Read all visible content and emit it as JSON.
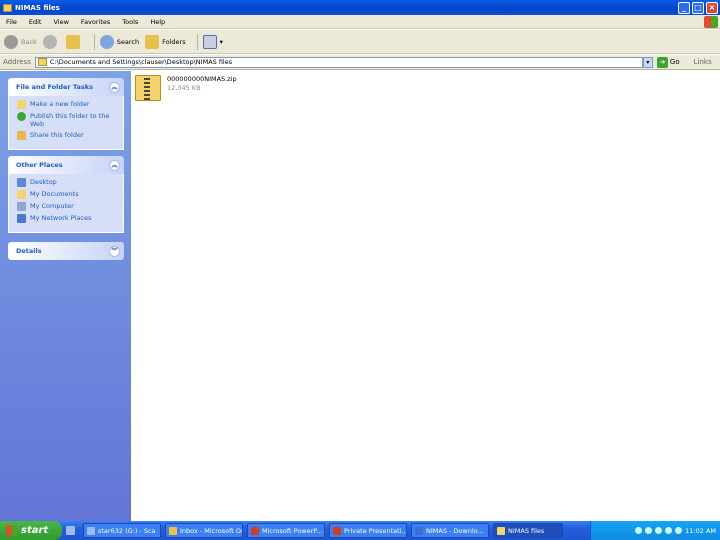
{
  "window": {
    "title": "NIMAS files",
    "controls": {
      "minimize": "_",
      "maximize": "□",
      "close": "×"
    }
  },
  "menu": [
    "File",
    "Edit",
    "View",
    "Favorites",
    "Tools",
    "Help"
  ],
  "toolbar": {
    "back": "Back",
    "forward": "",
    "search": "Search",
    "folders": "Folders"
  },
  "address": {
    "label": "Address",
    "value": "C:\\Documents and Settings\\clauser\\Desktop\\NIMAS files",
    "go": "Go",
    "links": "Links"
  },
  "taskpane": {
    "file_folder_tasks": {
      "title": "File and Folder Tasks",
      "items": [
        "Make a new folder",
        "Publish this folder to the Web",
        "Share this folder"
      ]
    },
    "other_places": {
      "title": "Other Places",
      "items": [
        "Desktop",
        "My Documents",
        "My Computer",
        "My Network Places"
      ]
    },
    "details": {
      "title": "Details"
    }
  },
  "files": [
    {
      "name": "000000000NIMAS.zip",
      "sub": "12,345 KB"
    }
  ],
  "taskbar": {
    "start": "start",
    "tasks": [
      "star632 (G:) - Sca",
      "Inbox - Microsoft Outl...",
      "Microsoft PowerP...",
      "Private Presentati...",
      "NIMAS - Downlo...",
      "NIMAS files"
    ],
    "clock": "11:02 AM"
  },
  "colors": {
    "titlebar": "#0343c9",
    "taskpane": "#6f8ce0",
    "start": "#2f9a2e"
  }
}
